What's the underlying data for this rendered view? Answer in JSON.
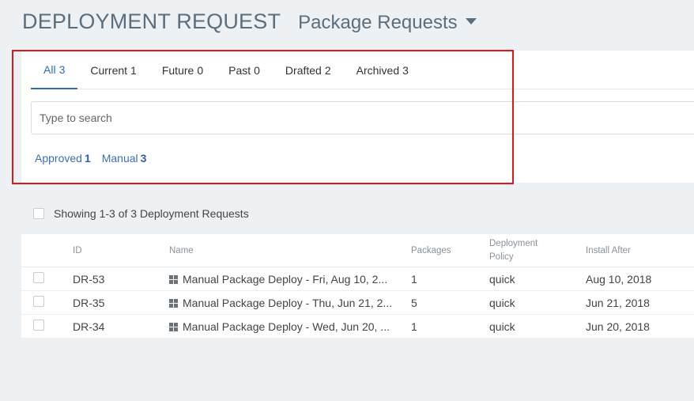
{
  "header": {
    "title": "DEPLOYMENT REQUEST",
    "subtitle": "Package Requests"
  },
  "tabs": [
    {
      "label": "All",
      "count": "3",
      "active": true
    },
    {
      "label": "Current",
      "count": "1"
    },
    {
      "label": "Future",
      "count": "0"
    },
    {
      "label": "Past",
      "count": "0"
    },
    {
      "label": "Drafted",
      "count": "2"
    },
    {
      "label": "Archived",
      "count": "3"
    }
  ],
  "search": {
    "placeholder": "Type to search",
    "value": ""
  },
  "quick_filters": [
    {
      "label": "Approved",
      "count": "1"
    },
    {
      "label": "Manual",
      "count": "3"
    }
  ],
  "summary": {
    "showing": "Showing 1-3 of 3 Deployment Requests"
  },
  "table": {
    "columns": {
      "id": "ID",
      "name": "Name",
      "packages": "Packages",
      "policy": "Deployment Policy",
      "install_after": "Install After"
    },
    "rows": [
      {
        "id": "DR-53",
        "name": "Manual Package Deploy - Fri, Aug 10, 2...",
        "packages": "1",
        "policy": "quick",
        "install_after": "Aug 10, 2018"
      },
      {
        "id": "DR-35",
        "name": "Manual Package Deploy - Thu, Jun 21, 2...",
        "packages": "5",
        "policy": "quick",
        "install_after": "Jun 21, 2018"
      },
      {
        "id": "DR-34",
        "name": "Manual Package Deploy - Wed, Jun 20, ...",
        "packages": "1",
        "policy": "quick",
        "install_after": "Jun 20, 2018"
      }
    ]
  },
  "colors": {
    "accent": "#2d6cc4",
    "highlight": "#e3141b",
    "title": "#5b6e7d"
  },
  "icons": {
    "os": "windows-icon",
    "dropdown": "caret-down-icon"
  }
}
